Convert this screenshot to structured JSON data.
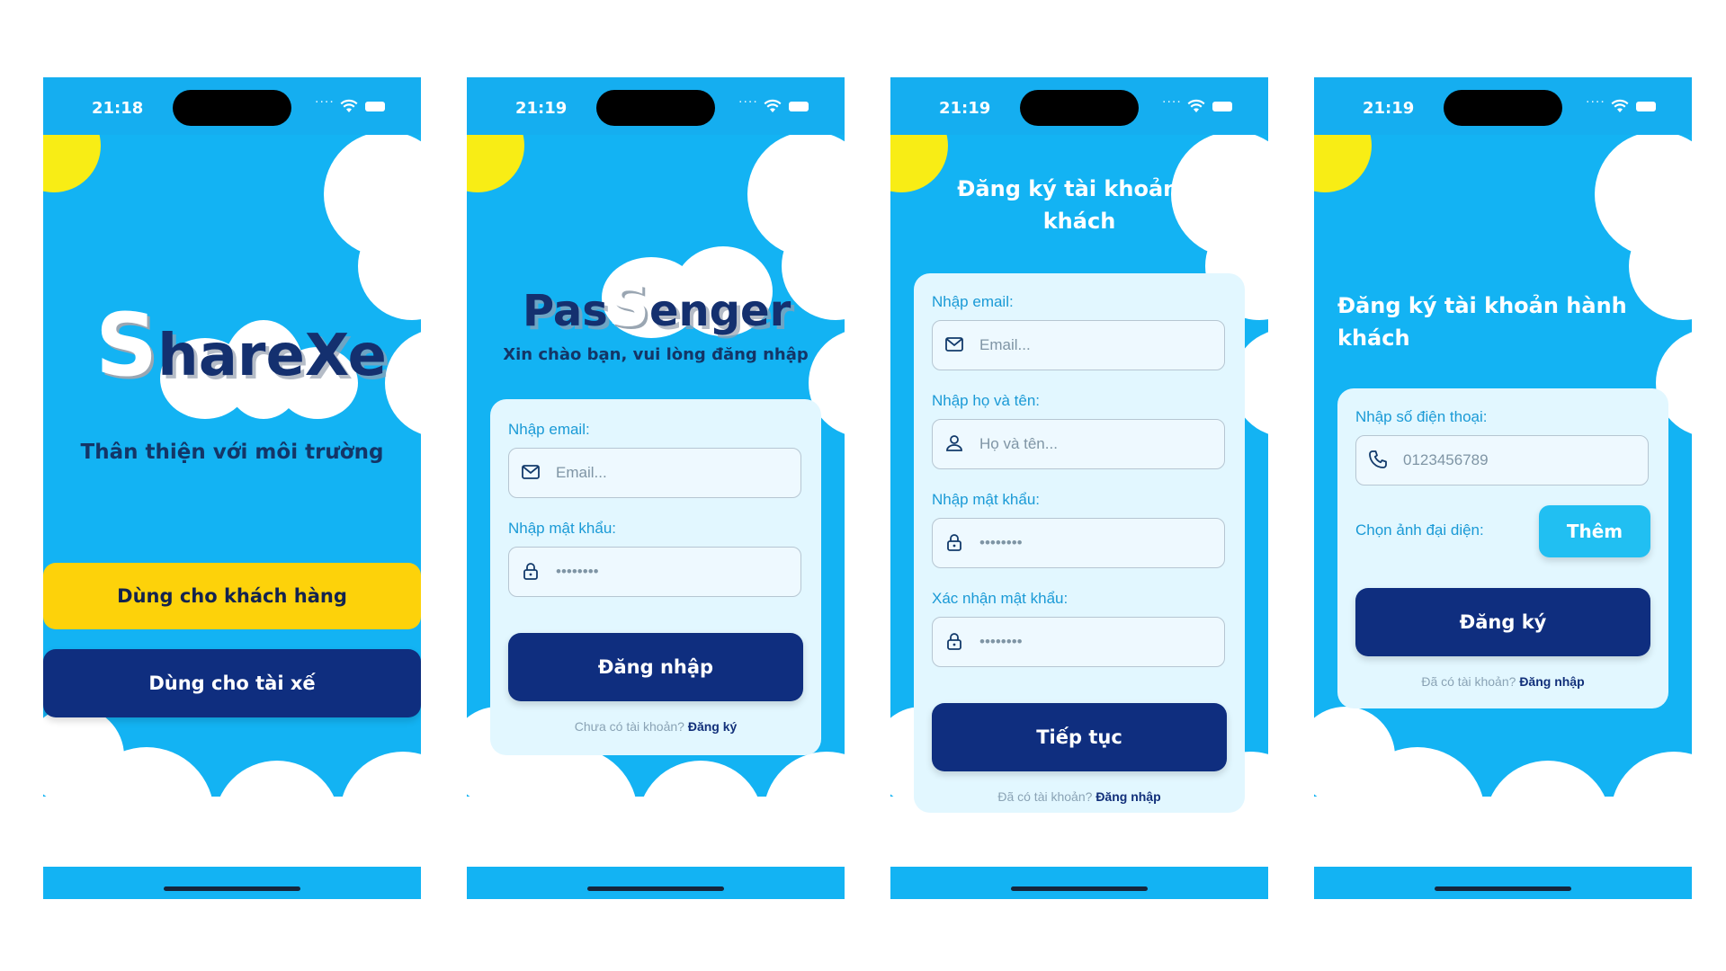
{
  "screens": [
    {
      "time": "21:18",
      "logo": {
        "cap": "S",
        "rest": "hareXe"
      },
      "tagline": "Thân thiện với môi trường",
      "customer_button": "Dùng cho khách hàng",
      "driver_button": "Dùng cho tài xế"
    },
    {
      "time": "21:19",
      "logo": {
        "pre": "Pas",
        "cap": "S",
        "rest": "enger"
      },
      "subtitle": "Xin chào bạn, vui lòng đăng nhập",
      "email_label": "Nhập email:",
      "email_placeholder": "Email...",
      "password_label": "Nhập mật khẩu:",
      "password_value": "••••••••",
      "login_button": "Đăng nhập",
      "footer_text": "Chưa có tài khoản?",
      "footer_link": "Đăng ký"
    },
    {
      "time": "21:19",
      "title_line1": "Đăng ký tài khoản h",
      "title_line2": "khách",
      "email_label": "Nhập email:",
      "email_placeholder": "Email...",
      "name_label": "Nhập họ và tên:",
      "name_placeholder": "Họ và tên...",
      "password_label": "Nhập mật khẩu:",
      "password_value": "••••••••",
      "confirm_label": "Xác nhận mật khẩu:",
      "confirm_value": "••••••••",
      "continue_button": "Tiếp tục",
      "footer_text": "Đã có tài khoản?",
      "footer_link": "Đăng nhập"
    },
    {
      "time": "21:19",
      "title_line1": "Đăng ký tài khoản hành",
      "title_line2": "khách",
      "phone_label": "Nhập số điện thoại:",
      "phone_placeholder": "0123456789",
      "avatar_label": "Chọn ảnh đại diện:",
      "add_button": "Thêm",
      "register_button": "Đăng ký",
      "footer_text": "Đã có tài khoản?",
      "footer_link": "Đăng nhập"
    }
  ],
  "colors": {
    "sky": "#13b3f3",
    "navy": "#0f2e7f",
    "yellow": "#fdd20a",
    "sun": "#f8ed15",
    "card": "#e2f7ff",
    "label": "#1a9ad6"
  },
  "icons": [
    "wifi-icon",
    "battery-icon",
    "mail-icon",
    "lock-icon",
    "user-icon",
    "phone-icon"
  ]
}
